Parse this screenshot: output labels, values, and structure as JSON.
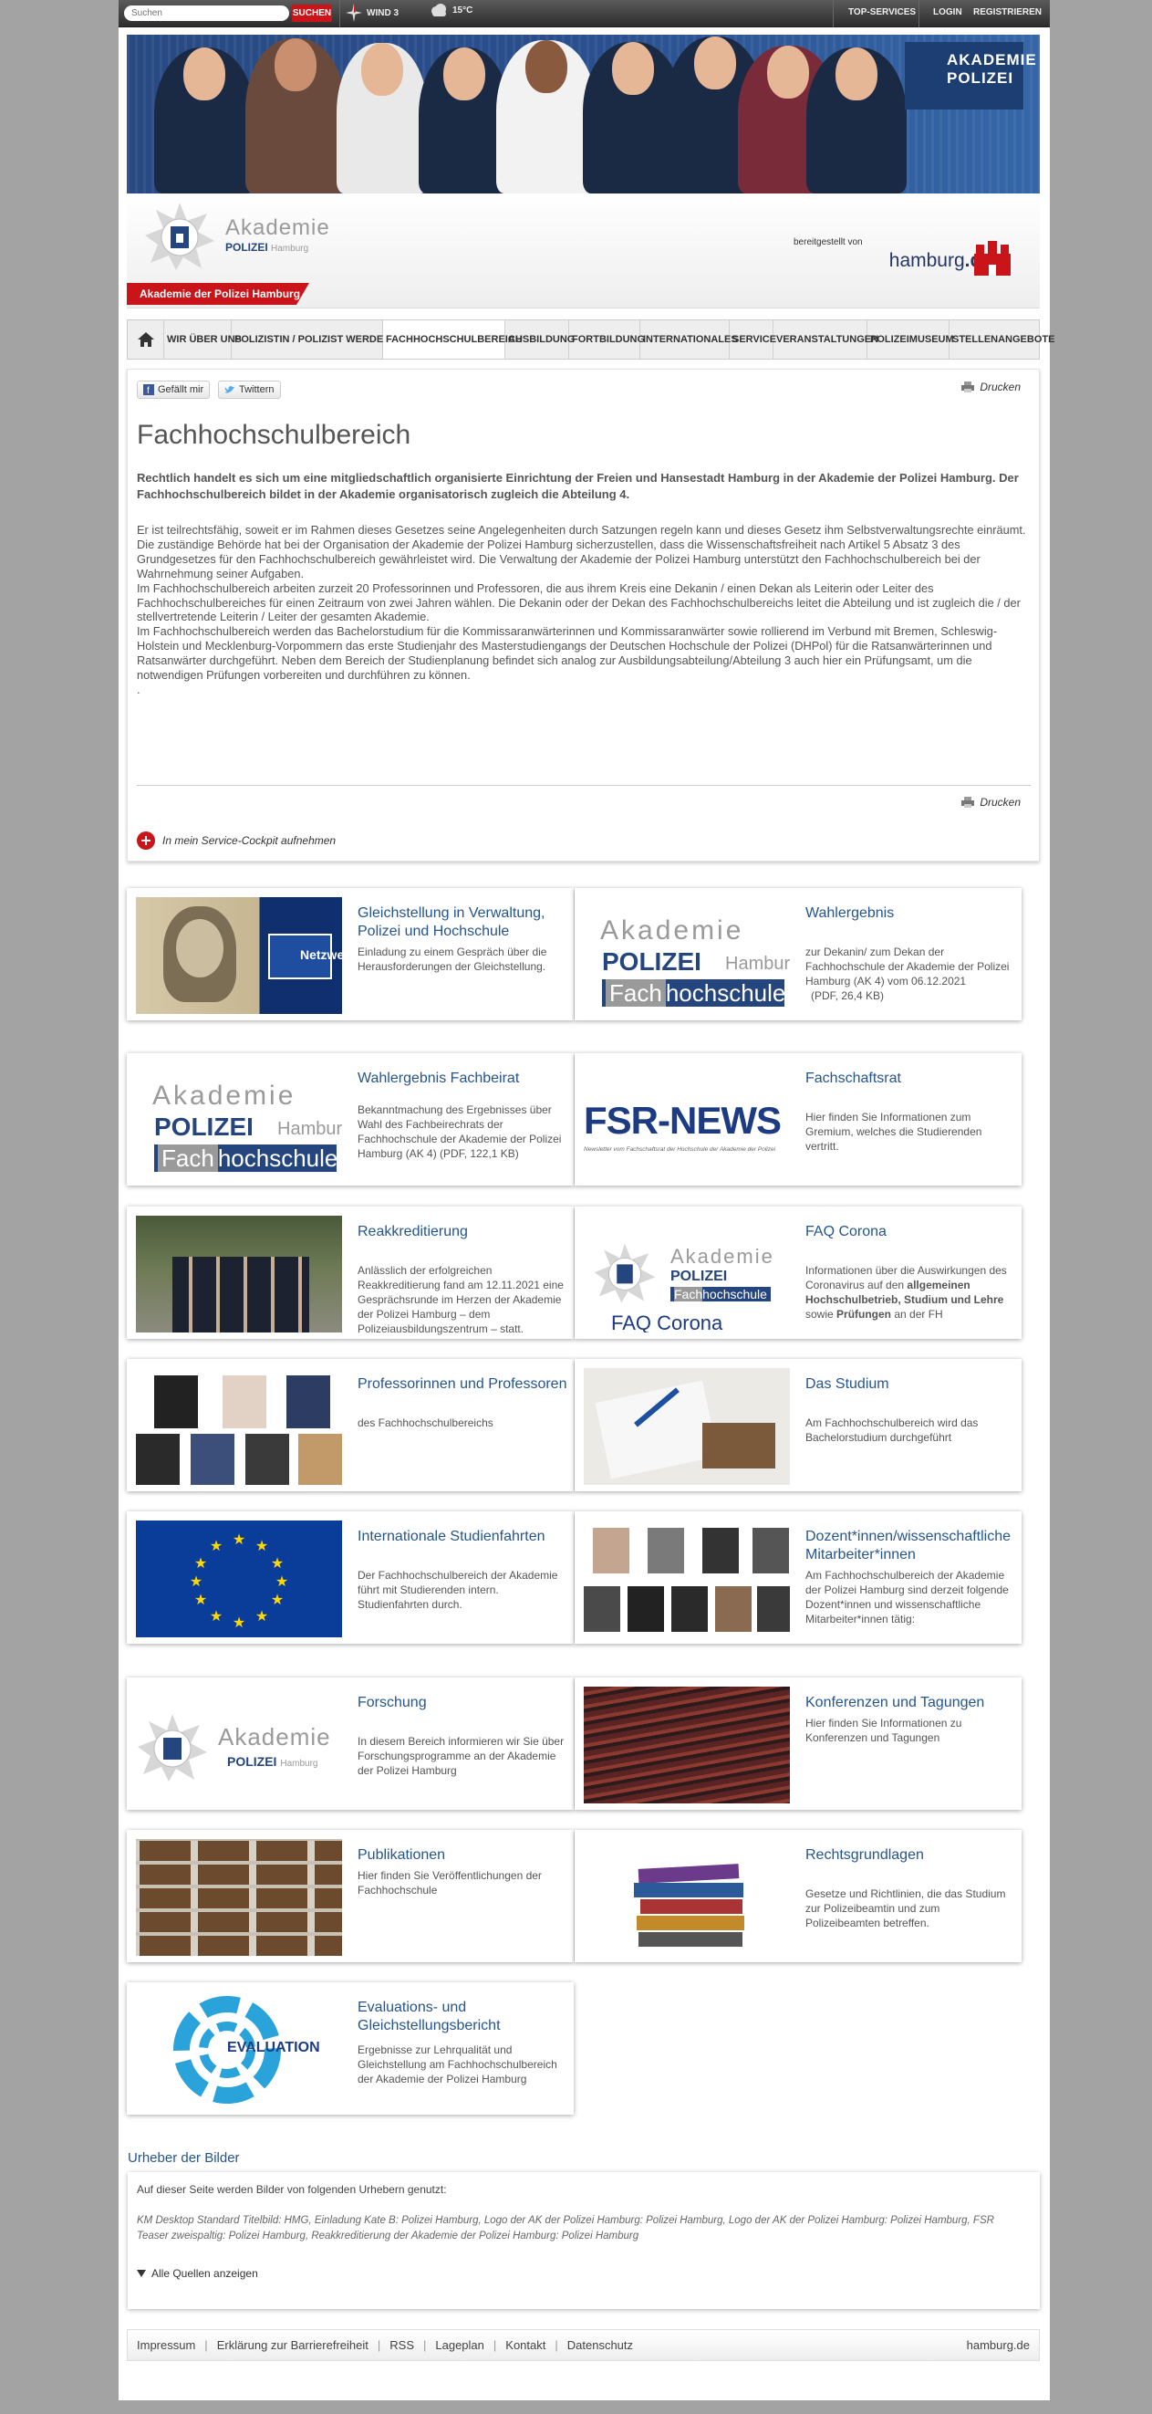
{
  "topbar": {
    "search_placeholder": "Suchen",
    "search_button": "SUCHEN",
    "wind": "WIND 3",
    "temperature": "15°C",
    "top_services": "TOP-SERVICES",
    "login": "LOGIN",
    "register": "REGISTRIEREN"
  },
  "header": {
    "logo_line1": "Akademie",
    "logo_line2": "POLIZEI",
    "logo_line2_city": "Hamburg",
    "provided_by": "bereitgestellt von",
    "hamburg_brand": "hamburg",
    "hamburg_tld": ".de",
    "section_tab": "Akademie der Polizei Hamburg",
    "hero_sign_line1": "AKADEMIE",
    "hero_sign_line2": "POLIZEI"
  },
  "nav": {
    "items": [
      "WIR ÜBER UNS",
      "POLIZISTIN / POLIZIST WERDEN",
      "FACHHOCHSCHULBEREICH",
      "AUSBILDUNG",
      "FORTBILDUNG",
      "INTERNATIONALES",
      "SERVICE",
      "VERANSTALTUNGEN",
      "POLIZEIMUSEUM",
      "STELLENANGEBOTE"
    ]
  },
  "content": {
    "like": "Gefällt mir",
    "tweet": "Twittern",
    "print": "Drucken",
    "title": "Fachhochschulbereich",
    "lead": "Rechtlich handelt es sich um eine mitgliedschaftlich organisierte Einrichtung der Freien und Hansestadt Hamburg in der Akademie der Polizei Hamburg. Der Fachhochschulbereich bildet in der Akademie organisatorisch zugleich die Abteilung 4.",
    "body": "Er ist teilrechtsfähig, soweit er im Rahmen dieses Gesetzes seine Angelegenheiten durch Satzungen regeln kann und dieses Gesetz ihm Selbstverwaltungsrechte einräumt. Die zuständige Behörde hat bei der Organisation der Akademie der Polizei Hamburg sicherzustellen, dass die Wissenschaftsfreiheit nach Artikel 5 Absatz 3 des Grundgesetzes für den Fachhochschulbereich gewährleistet wird. Die Verwaltung der Akademie der Polizei Hamburg unterstützt den Fachhochschulbereich bei der Wahrnehmung seiner Aufgaben.\nIm Fachhochschulbereich arbeiten zurzeit 20 Professorinnen und Professoren, die aus ihrem Kreis eine Dekanin / einen Dekan als Leiterin oder Leiter des Fachhochschulbereiches für einen Zeitraum von zwei Jahren wählen. Die Dekanin oder der Dekan des Fachhochschulbereichs leitet die Abteilung und ist zugleich die / der stellvertretende Leiterin / Leiter der gesamten Akademie.\nIm Fachhochschulbereich werden das Bachelorstudium für die Kommissaranwärterinnen und Kommissaranwärter sowie rollierend im Verbund mit Bremen, Schleswig-Holstein und Mecklenburg-Vorpommern das erste Studienjahr des Masterstudiengangs der Deutschen Hochschule der Polizei (DHPol) für die Ratsanwärterinnen und Ratsanwärter durchgeführt. Neben dem Bereich der Studienplanung befindet sich analog zur Ausbildungsabteilung/Abteilung 3 auch hier ein Prüfungsamt, um die notwendigen Prüfungen vorbereiten und durchführen zu können.\n.",
    "cockpit": "In mein Service-Cockpit aufnehmen"
  },
  "cards": [
    {
      "title": "Gleichstellung in Verwaltung, Polizei und Hochschule",
      "text": "Einladung zu einem Gespräch über die Herausforderungen der Gleichstellung.",
      "img": "woman-portrait",
      "badge": "Netzwerk"
    },
    {
      "title": "Wahlergebnis",
      "text": "zur Dekanin/ zum Dekan der Fachhochschule der Akademie der Polizei Hamburg (AK 4) vom 06.12.2021",
      "extra": "(PDF, 26,4 KB)",
      "img": "fh-logo"
    },
    {
      "title": "Wahlergebnis Fachbeirat",
      "text": "Bekanntmachung des Ergebnisses über Wahl des Fachbeirechrats der Fachhochschule der Akademie der Polizei Hamburg (AK 4)",
      "extra": "(PDF, 122,1 KB)",
      "img": "fh-logo"
    },
    {
      "title": "Fachschaftsrat",
      "text": "Hier finden Sie Informationen zum Gremium, welches die Studierenden vertritt.",
      "img": "fsr-news",
      "badge": "FSR-NEWS",
      "badge_sub": "Newsletter vom Fachschaftsrat der Hochschule der Akademie der Polizei"
    },
    {
      "title": "Reakkreditierung",
      "text": "Anlässlich der erfolgreichen Reakkreditierung fand am 12.11.2021 eine Gesprächsrunde im Herzen der Akademie der Polizei Hamburg – dem Polizeiausbildungszentrum – statt.",
      "img": "group-photo"
    },
    {
      "title": "FAQ Corona",
      "text_parts": [
        "Informationen über die Auswirkungen des Coronavirus auf den ",
        "allgemeinen Hochschulbetrieb, Studium und Lehre",
        " sowie ",
        "Prüfungen",
        " an der FH"
      ],
      "img": "faq-logo",
      "badge": "FAQ Corona"
    },
    {
      "title": "Professorinnen und Professoren",
      "text": "des Fachhochschulbereichs",
      "img": "portraits"
    },
    {
      "title": "Das Studium",
      "text": "Am Fachhochschulbereich wird das Bachelorstudium durchgeführt",
      "img": "writing"
    },
    {
      "title": "Internationale Studienfahrten",
      "text": "Der Fachhochschulbereich der Akademie führt mit Studierenden intern. Studienfahrten durch.",
      "img": "eu-flag"
    },
    {
      "title": "Dozent*innen/wissenschaftliche Mitarbeiter*innen",
      "text": "Am Fachhochschulbereich der Akademie der Polizei Hamburg sind derzeit folgende Dozent*innen und wissenschaftliche Mitarbeiter*innen tätig:",
      "img": "portraits2"
    },
    {
      "title": "Forschung",
      "text": "In diesem Bereich informieren wir Sie über Forschungsprogramme an der Akademie der Polizei Hamburg",
      "img": "akademie-logo"
    },
    {
      "title": "Konferenzen und Tagungen",
      "text": "Hier finden Sie Informationen zu Konferenzen und Tagungen",
      "img": "auditorium"
    },
    {
      "title": "Publikationen",
      "text": "Hier finden Sie Veröffentlichungen der Fachhochschule",
      "img": "library"
    },
    {
      "title": "Rechtsgrundlagen",
      "text": "Gesetze und Richtlinien, die das Studium zur Polizeibeamtin und zum Polizeibeamten betreffen.",
      "img": "books"
    },
    {
      "title": "Evaluations- und Gleichstellungsbericht",
      "text": "Ergebnisse zur Lehrqualität und Gleichstellung am Fachhochschulbereich der Akademie der Polizei Hamburg",
      "img": "evaluation",
      "badge": "EVALUATION"
    }
  ],
  "urheber": {
    "title": "Urheber der Bilder",
    "intro": "Auf dieser Seite werden Bilder von folgenden Urhebern genutzt:",
    "credits": "KM Desktop Standard Titelbild: HMG, Einladung Kate B: Polizei Hamburg, Logo der AK der Polizei Hamburg: Polizei Hamburg, Logo der AK der Polizei Hamburg: Polizei Hamburg, FSR Teaser zweispaltig: Polizei Hamburg, Reakkreditierung der Akademie der Polizei Hamburg: Polizei Hamburg",
    "show_all": "Alle Quellen anzeigen"
  },
  "footer": {
    "links": [
      "Impressum",
      "Erklärung zur Barrierefreiheit",
      "RSS",
      "Lageplan",
      "Kontakt",
      "Datenschutz"
    ],
    "right": "hamburg.de"
  },
  "logo_fh": {
    "l1": "Akademie",
    "l2": "POLIZEI",
    "l3": "Hamburg",
    "fach": "Fach",
    "hochschule": "hochschule"
  }
}
